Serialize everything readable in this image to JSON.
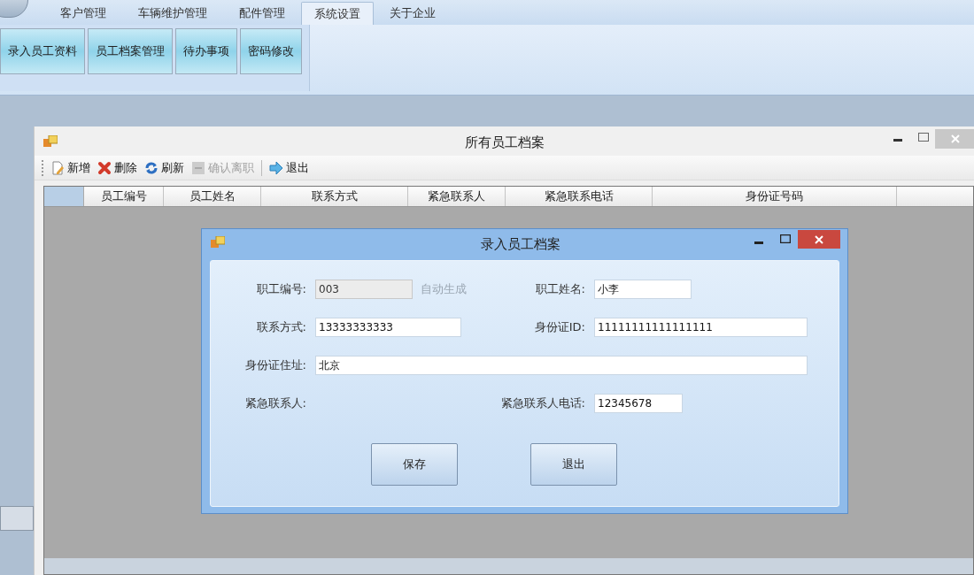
{
  "ribbon": {
    "tabs": [
      {
        "label": "客户管理",
        "selected": false
      },
      {
        "label": "车辆维护管理",
        "selected": false
      },
      {
        "label": "配件管理",
        "selected": false
      },
      {
        "label": "系统设置",
        "selected": true
      },
      {
        "label": "关于企业",
        "selected": false
      }
    ],
    "buttons": [
      "录入员工资料",
      "员工档案管理",
      "待办事项",
      "密码修改"
    ]
  },
  "archive_window": {
    "title": "所有员工档案",
    "toolbar": [
      {
        "label": "新增",
        "kind": "new",
        "disabled": false
      },
      {
        "label": "删除",
        "kind": "delete",
        "disabled": false
      },
      {
        "label": "刷新",
        "kind": "refresh",
        "disabled": false
      },
      {
        "label": "确认离职",
        "kind": "confirm",
        "disabled": true
      },
      {
        "label": "退出",
        "kind": "exit",
        "disabled": false
      }
    ],
    "columns": [
      "员工编号",
      "员工姓名",
      "联系方式",
      "紧急联系人",
      "紧急联系电话",
      "身份证号码"
    ]
  },
  "dialog": {
    "title": "录入员工档案",
    "fields": [
      {
        "label": "职工编号:",
        "kind": "readonly",
        "value": "003",
        "note": "自动生成"
      },
      {
        "label": "职工姓名:",
        "kind": "text",
        "value": "小李"
      },
      {
        "label": "联系方式:",
        "kind": "text",
        "value": "13333333333"
      },
      {
        "label": "身份证ID:",
        "kind": "text",
        "value": "11111111111111111"
      },
      {
        "label": "身份证住址:",
        "kind": "text",
        "value": "北京"
      },
      {
        "label": "紧急联系人:",
        "kind": "none"
      },
      {
        "label": "紧急联系人电话:",
        "kind": "text",
        "value": "12345678"
      }
    ],
    "buttons": [
      "保存",
      "退出"
    ]
  }
}
